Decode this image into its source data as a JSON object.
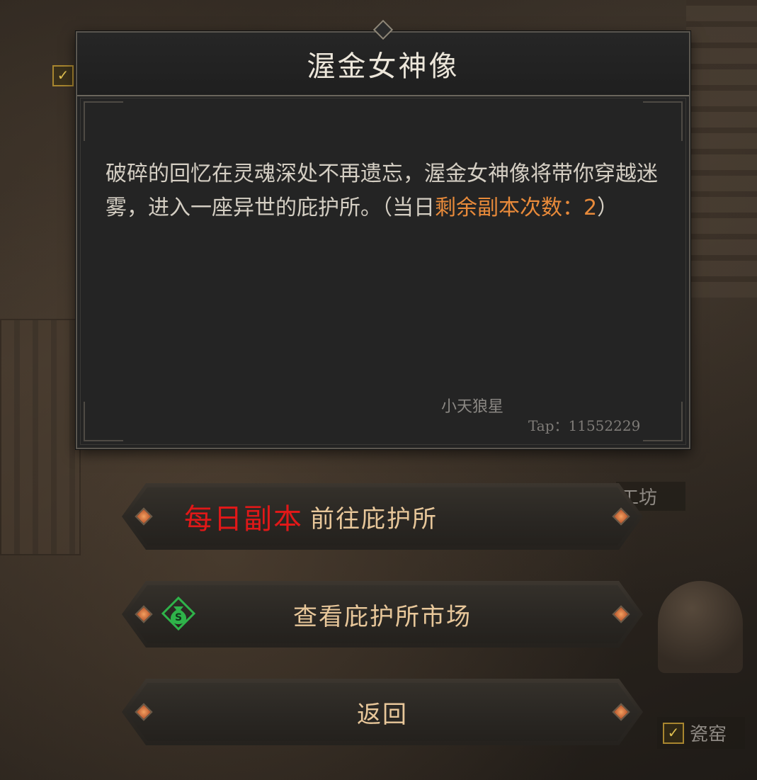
{
  "dialog": {
    "title": "渥金女神像",
    "description_main": "破碎的回忆在灵魂深处不再遗忘，渥金女神像将带你穿越迷雾，进入一座异世的庇护所。（当日",
    "description_highlight": "剩余副本次数：2",
    "description_end": "）",
    "watermark_name": "小天狼星",
    "watermark_tap": "Tap：11552229"
  },
  "buttons": {
    "daily_tag": "每日副本",
    "goto_shelter": "前往庇护所",
    "view_market": "查看庇护所市场",
    "back": "返回"
  },
  "background": {
    "factory_label": "工坊",
    "kiln_label": "瓷窑"
  },
  "colors": {
    "highlight": "#e88a3a",
    "daily_tag": "#e01818",
    "button_text": "#e8c79a",
    "money_icon": "#2fb34a"
  }
}
